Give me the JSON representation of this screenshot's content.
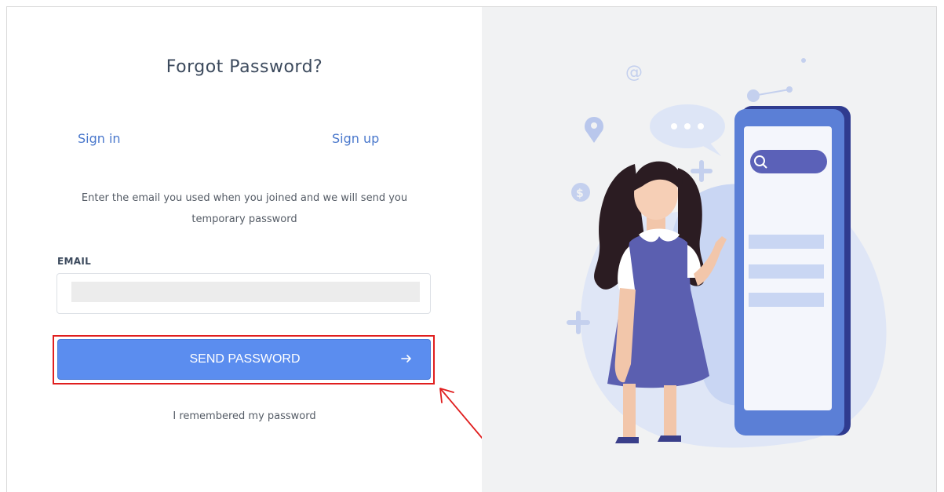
{
  "form": {
    "title": "Forgot Password?",
    "tabs": {
      "sign_in": "Sign in",
      "sign_up": "Sign up"
    },
    "description": "Enter the email you used when you joined and we will send you temporary password",
    "email": {
      "label": "EMAIL",
      "value": "",
      "placeholder": ""
    },
    "submit": {
      "label": "SEND PASSWORD",
      "icon": "arrow-right-icon"
    },
    "remember_link": "I remembered my password"
  },
  "illustration": {
    "icons": [
      "at-sign-icon",
      "location-pin-icon",
      "chat-bubble-icon",
      "dollar-icon",
      "plus-icon",
      "search-icon"
    ]
  },
  "annotation": {
    "highlight_color": "#e01e1e"
  },
  "colors": {
    "accent": "#5b8def",
    "link": "#4a78cc",
    "panel_bg": "#f1f2f3"
  }
}
